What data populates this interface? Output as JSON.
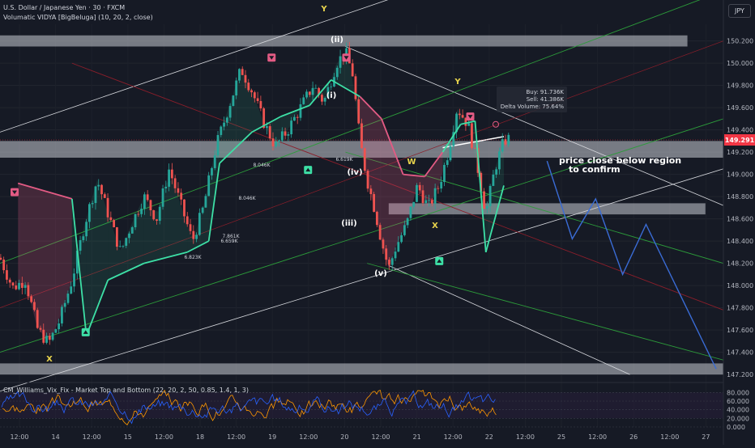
{
  "header": {
    "symbol": "U.S. Dollar / Japanese Yen · 30 · FXCM",
    "indicator": "Volumatic VIDYA [BigBeluga] (10, 20, 2, close)",
    "currency": "JPY"
  },
  "oscillator": {
    "title": "CM_Williams_Vix_Fix - Market Top and Bottom (22, 20, 2, 50, 0.85, 1.4, 1, 3)",
    "ticks": [
      "80.000",
      "60.000",
      "40.000",
      "20.000",
      "0.000"
    ]
  },
  "annotations": {
    "stats": [
      "Buy: 91.736K",
      "Sell: 41.386K",
      "Delta Volume: 75.64%"
    ],
    "note": [
      "price close below region",
      "to confirm"
    ],
    "waves": [
      {
        "label": "Y",
        "color": "#e8d44d"
      },
      {
        "label": "(ii)",
        "color": "#ffffff"
      },
      {
        "label": "(i)",
        "color": "#ffffff"
      },
      {
        "label": "(iv)",
        "color": "#ffffff"
      },
      {
        "label": "(iii)",
        "color": "#ffffff"
      },
      {
        "label": "(v)",
        "color": "#ffffff"
      },
      {
        "label": "W",
        "color": "#e8d44d"
      },
      {
        "label": "Y",
        "color": "#e8d44d"
      },
      {
        "label": "X",
        "color": "#e8d44d"
      },
      {
        "label": "X",
        "color": "#e8d44d"
      }
    ],
    "volume_labels": [
      "8.046K",
      "6.619K",
      "8.046K",
      "7.861K",
      "6.659K",
      "6.823K"
    ]
  },
  "chart_data": {
    "type": "line",
    "price_ticks": [
      "150.200",
      "150.000",
      "149.800",
      "149.600",
      "149.400",
      "149.200",
      "149.000",
      "148.800",
      "148.600",
      "148.400",
      "148.200",
      "148.000",
      "147.800",
      "147.600",
      "147.400",
      "147.200"
    ],
    "current_price": "149.291",
    "time_ticks": [
      "12:00",
      "14",
      "12:00",
      "15",
      "12:00",
      "18",
      "12:00",
      "19",
      "12:00",
      "20",
      "12:00",
      "21",
      "12:00",
      "22",
      "12:00",
      "25",
      "12:00",
      "26",
      "12:00",
      "27"
    ],
    "x_range": [
      0,
      20.1
    ],
    "ylim": [
      147.15,
      150.35
    ],
    "price_series": [
      [
        0,
        148.25
      ],
      [
        0.35,
        147.98
      ],
      [
        0.7,
        148.05
      ],
      [
        1.05,
        147.6
      ],
      [
        1.35,
        147.48
      ],
      [
        1.65,
        147.68
      ],
      [
        2.0,
        148.05
      ],
      [
        2.35,
        148.55
      ],
      [
        2.7,
        148.95
      ],
      [
        3.0,
        148.65
      ],
      [
        3.35,
        148.3
      ],
      [
        3.65,
        148.55
      ],
      [
        4.0,
        148.8
      ],
      [
        4.35,
        148.6
      ],
      [
        4.7,
        149.05
      ],
      [
        5.0,
        148.75
      ],
      [
        5.35,
        148.4
      ],
      [
        5.65,
        148.7
      ],
      [
        6.0,
        149.25
      ],
      [
        6.35,
        149.6
      ],
      [
        6.7,
        149.95
      ],
      [
        7.0,
        149.75
      ],
      [
        7.35,
        149.45
      ],
      [
        7.65,
        149.25
      ],
      [
        8.0,
        149.4
      ],
      [
        8.35,
        149.6
      ],
      [
        8.7,
        149.8
      ],
      [
        9.0,
        149.65
      ],
      [
        9.35,
        150.0
      ],
      [
        9.6,
        150.1
      ],
      [
        9.8,
        149.9
      ],
      [
        10.0,
        149.3
      ],
      [
        10.2,
        148.95
      ],
      [
        10.4,
        148.7
      ],
      [
        10.6,
        148.4
      ],
      [
        10.8,
        148.15
      ],
      [
        11.0,
        148.35
      ],
      [
        11.3,
        148.55
      ],
      [
        11.6,
        148.9
      ],
      [
        11.9,
        148.7
      ],
      [
        12.2,
        148.9
      ],
      [
        12.45,
        149.2
      ],
      [
        12.7,
        149.6
      ],
      [
        13.0,
        149.45
      ],
      [
        13.25,
        149.1
      ],
      [
        13.5,
        148.65
      ],
      [
        13.75,
        149.05
      ],
      [
        14.0,
        149.3
      ],
      [
        14.2,
        149.33
      ]
    ],
    "vidya_series": [
      [
        0.5,
        148.92
      ],
      [
        2.0,
        148.78
      ],
      [
        2.4,
        147.55
      ],
      [
        3.0,
        148.05
      ],
      [
        4.0,
        148.2
      ],
      [
        5.2,
        148.3
      ],
      [
        5.8,
        148.4
      ],
      [
        6.1,
        149.1
      ],
      [
        7.0,
        149.38
      ],
      [
        7.8,
        149.52
      ],
      [
        8.6,
        149.62
      ],
      [
        9.2,
        149.85
      ],
      [
        10.0,
        149.7
      ],
      [
        10.6,
        149.5
      ],
      [
        11.2,
        149.0
      ],
      [
        11.8,
        148.98
      ],
      [
        12.3,
        149.2
      ],
      [
        12.8,
        149.45
      ],
      [
        13.2,
        149.48
      ],
      [
        13.5,
        148.3
      ],
      [
        14.0,
        148.9
      ]
    ],
    "zones": [
      [
        150.15,
        150.25
      ],
      [
        149.15,
        149.3
      ],
      [
        148.64,
        148.74
      ],
      [
        147.2,
        147.3
      ]
    ],
    "projection": [
      [
        15.2,
        149.12
      ],
      [
        15.9,
        148.42
      ],
      [
        16.55,
        148.78
      ],
      [
        17.3,
        148.1
      ],
      [
        17.95,
        148.55
      ],
      [
        19.9,
        147.25
      ]
    ],
    "oscillator_range": [
      0,
      90
    ]
  }
}
